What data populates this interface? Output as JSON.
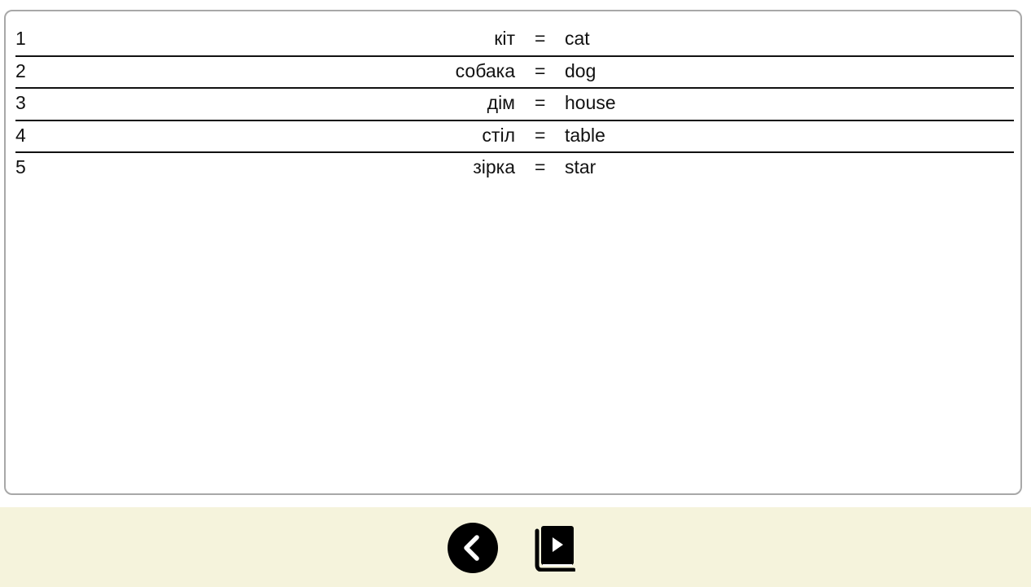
{
  "vocab": {
    "rows": [
      {
        "num": "1",
        "word": "кіт",
        "eq": "=",
        "translation": "cat"
      },
      {
        "num": "2",
        "word": "собака",
        "eq": "=",
        "translation": "dog"
      },
      {
        "num": "3",
        "word": "дім",
        "eq": "=",
        "translation": "house"
      },
      {
        "num": "4",
        "word": "стіл",
        "eq": "=",
        "translation": "table"
      },
      {
        "num": "5",
        "word": "зірка",
        "eq": "=",
        "translation": "star"
      }
    ]
  },
  "footer": {
    "back_icon": "chevron-left-icon",
    "book_icon": "video-library-book-icon",
    "background_color": "#f5f3dc"
  }
}
